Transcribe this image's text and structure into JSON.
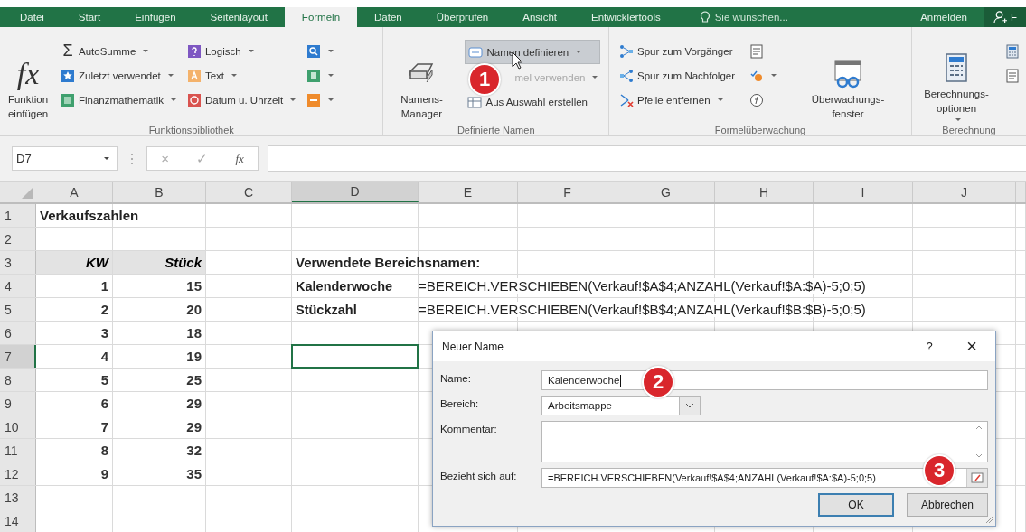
{
  "ribbon_tabs": [
    {
      "label": "Datei",
      "selected": false
    },
    {
      "label": "Start",
      "selected": false
    },
    {
      "label": "Einfügen",
      "selected": false
    },
    {
      "label": "Seitenlayout",
      "selected": false
    },
    {
      "label": "Formeln",
      "selected": true
    },
    {
      "label": "Daten",
      "selected": false
    },
    {
      "label": "Überprüfen",
      "selected": false
    },
    {
      "label": "Ansicht",
      "selected": false
    },
    {
      "label": "Entwicklertools",
      "selected": false
    }
  ],
  "tell_me": "Sie wünschen...",
  "sign_in": "Anmelden",
  "share": "F",
  "ribbon_groups": [
    {
      "label": "Funktionsbibliothek",
      "columns": [
        [
          {
            "kind": "large",
            "glyph": "fx",
            "label": "Funktion einfügen",
            "dropdown": false
          }
        ],
        [
          {
            "kind": "small",
            "glyph": "Σ",
            "label": "AutoSumme",
            "dropdown": true
          },
          {
            "kind": "small",
            "label": "Zuletzt verwendet",
            "dropdown": true
          },
          {
            "kind": "small",
            "label": "Finanzmathematik",
            "dropdown": true
          }
        ],
        [
          {
            "kind": "small",
            "label": "Logisch",
            "dropdown": true
          },
          {
            "kind": "small",
            "label": "Text",
            "dropdown": true
          },
          {
            "kind": "small",
            "label": "Datum u. Uhrzeit",
            "dropdown": true
          }
        ],
        [
          {
            "kind": "icon",
            "dropdown": true
          },
          {
            "kind": "icon",
            "dropdown": true
          },
          {
            "kind": "icon",
            "dropdown": true
          }
        ]
      ]
    },
    {
      "label": "Definierte Namen",
      "columns": [
        [
          {
            "kind": "large",
            "label": "Namens-Manager",
            "dropdown": false
          }
        ],
        [
          {
            "kind": "small",
            "label": "Namen definieren",
            "dropdown": true,
            "highlighted": true
          },
          {
            "kind": "small",
            "label": "mel verwenden",
            "dropdown": true,
            "disabled": true
          },
          {
            "kind": "small",
            "label": "Aus Auswahl erstellen",
            "dropdown": false
          }
        ]
      ]
    },
    {
      "label": "Formelüberwachung",
      "columns": [
        [
          {
            "kind": "small",
            "label": "Spur zum Vorgänger",
            "dropdown": false
          },
          {
            "kind": "small",
            "label": "Spur zum Nachfolger",
            "dropdown": false
          },
          {
            "kind": "small",
            "label": "Pfeile entfernen",
            "dropdown": true
          }
        ],
        [
          {
            "kind": "icon",
            "dropdown": false
          },
          {
            "kind": "icon",
            "dropdown": true
          },
          {
            "kind": "icon",
            "dropdown": false
          }
        ],
        [
          {
            "kind": "large",
            "label": "Überwachungs-fenster",
            "dropdown": false
          }
        ]
      ]
    },
    {
      "label": "Berechnung",
      "columns": [
        [
          {
            "kind": "large",
            "label": "Berechnungs-optionen",
            "dropdown": true
          }
        ],
        [
          {
            "kind": "icon",
            "dropdown": false
          },
          {
            "kind": "icon",
            "dropdown": false
          }
        ]
      ]
    }
  ],
  "formula_bar": {
    "name_box": "D7",
    "cancel": "×",
    "enter": "✓",
    "function": "fx"
  },
  "sheet": {
    "columns": [
      {
        "label": "A",
        "selected": false
      },
      {
        "label": "B",
        "selected": false
      },
      {
        "label": "C",
        "selected": false
      },
      {
        "label": "D",
        "selected": true
      },
      {
        "label": "E",
        "selected": false
      },
      {
        "label": "F",
        "selected": false
      },
      {
        "label": "G",
        "selected": false
      },
      {
        "label": "H",
        "selected": false
      },
      {
        "label": "I",
        "selected": false
      },
      {
        "label": "J",
        "selected": false
      }
    ],
    "rows": [
      {
        "label": "1",
        "selected": false,
        "a": {
          "text": "Verkaufszahlen",
          "kind": "title"
        }
      },
      {
        "label": "2",
        "selected": false
      },
      {
        "label": "3",
        "selected": false,
        "a": {
          "text": "KW",
          "kind": "header"
        },
        "b": {
          "text": "Stück",
          "kind": "header"
        },
        "d": {
          "text": "Verwendete Bereichsnamen:",
          "kind": "title"
        }
      },
      {
        "label": "4",
        "selected": false,
        "a": {
          "text": "1",
          "kind": "number"
        },
        "b": {
          "text": "15",
          "kind": "number"
        },
        "d": {
          "text": "Kalenderwoche",
          "kind": "label"
        },
        "e": {
          "text": "=BEREICH.VERSCHIEBEN(Verkauf!$A$4;ANZAHL(Verkauf!$A:$A)-5;0;5)",
          "kind": "formula"
        }
      },
      {
        "label": "5",
        "selected": false,
        "a": {
          "text": "2",
          "kind": "number"
        },
        "b": {
          "text": "20",
          "kind": "number"
        },
        "d": {
          "text": "Stückzahl",
          "kind": "label"
        },
        "e": {
          "text": "=BEREICH.VERSCHIEBEN(Verkauf!$B$4;ANZAHL(Verkauf!$B:$B)-5;0;5)",
          "kind": "formula"
        }
      },
      {
        "label": "6",
        "selected": false,
        "a": {
          "text": "3",
          "kind": "number"
        },
        "b": {
          "text": "18",
          "kind": "number"
        }
      },
      {
        "label": "7",
        "selected": true,
        "a": {
          "text": "4",
          "kind": "number"
        },
        "b": {
          "text": "19",
          "kind": "number"
        }
      },
      {
        "label": "8",
        "selected": false,
        "a": {
          "text": "5",
          "kind": "number"
        },
        "b": {
          "text": "25",
          "kind": "number"
        }
      },
      {
        "label": "9",
        "selected": false,
        "a": {
          "text": "6",
          "kind": "number"
        },
        "b": {
          "text": "29",
          "kind": "number"
        }
      },
      {
        "label": "10",
        "selected": false,
        "a": {
          "text": "7",
          "kind": "number"
        },
        "b": {
          "text": "29",
          "kind": "number"
        }
      },
      {
        "label": "11",
        "selected": false,
        "a": {
          "text": "8",
          "kind": "number"
        },
        "b": {
          "text": "32",
          "kind": "number"
        }
      },
      {
        "label": "12",
        "selected": false,
        "a": {
          "text": "9",
          "kind": "number"
        },
        "b": {
          "text": "35",
          "kind": "number"
        }
      },
      {
        "label": "13",
        "selected": false
      },
      {
        "label": "14",
        "selected": false
      }
    ]
  },
  "dialog": {
    "title": "Neuer Name",
    "help": "?",
    "close": "×",
    "fields": [
      {
        "kind": "text",
        "label": "Name:",
        "value": "Kalenderwoche",
        "focused": true
      },
      {
        "kind": "select",
        "label": "Bereich:",
        "value": "Arbeitsmappe"
      },
      {
        "kind": "textarea",
        "label": "Kommentar:"
      },
      {
        "kind": "reference",
        "label": "Bezieht sich auf:",
        "value": "=BEREICH.VERSCHIEBEN(Verkauf!$A$4;ANZAHL(Verkauf!$A:$A)-5;0;5)"
      }
    ],
    "buttons": [
      {
        "label": "OK",
        "default": true
      },
      {
        "label": "Abbrechen",
        "default": false
      }
    ]
  },
  "callouts": [
    {
      "text": "1"
    },
    {
      "text": "2"
    },
    {
      "text": "3"
    }
  ]
}
